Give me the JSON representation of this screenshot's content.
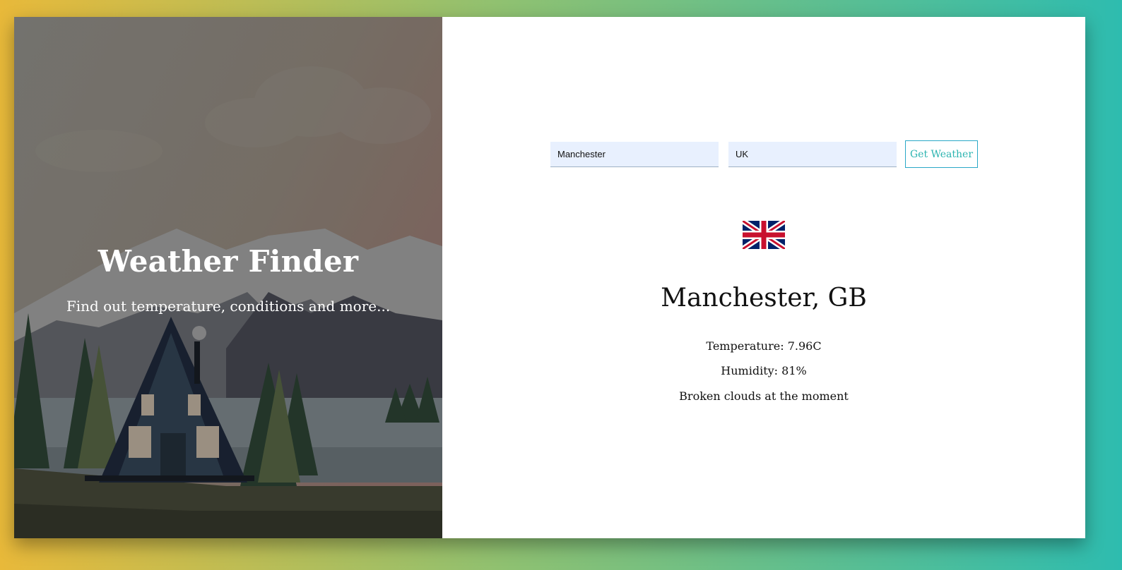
{
  "hero": {
    "title": "Weather Finder",
    "subtitle": "Find out temperature, conditions and more..."
  },
  "form": {
    "city_value": "Manchester",
    "country_value": "UK",
    "submit_label": "Get Weather"
  },
  "result": {
    "flag_icon": "uk-flag-icon",
    "location": "Manchester, GB",
    "temperature": "Temperature: 7.96C",
    "humidity": "Humidity: 81%",
    "description": "Broken clouds at the moment"
  },
  "colors": {
    "gradient_start": "#e8b93a",
    "gradient_end": "#2ebcaf",
    "accent": "#2cb4b0",
    "input_bg": "#e8f0fe"
  }
}
